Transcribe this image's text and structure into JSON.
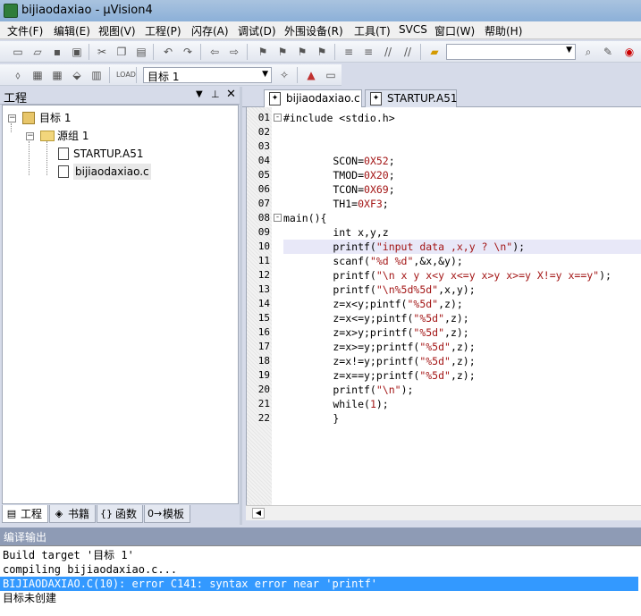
{
  "window": {
    "title": "bijiaodaxiao - µVision4"
  },
  "menu": [
    "文件(F)",
    "编辑(E)",
    "视图(V)",
    "工程(P)",
    "闪存(A)",
    "调试(D)",
    "外围设备(R)",
    "工具(T)",
    "SVCS",
    "窗口(W)",
    "帮助(H)"
  ],
  "toolbar2": {
    "target_select": "目标 1"
  },
  "project_panel": {
    "title": "工程",
    "tree": [
      {
        "label": "目标 1",
        "level": 0,
        "expander": "-",
        "icon": "target-folder-icon"
      },
      {
        "label": "源组 1",
        "level": 1,
        "expander": "-",
        "icon": "folder-icon"
      },
      {
        "label": "STARTUP.A51",
        "level": 2,
        "expander": "",
        "icon": "file-icon"
      },
      {
        "label": "bijiaodaxiao.c",
        "level": 2,
        "expander": "",
        "icon": "file-icon"
      }
    ],
    "tabs": [
      {
        "label": "工程",
        "icon": "project-icon",
        "active": true
      },
      {
        "label": "书籍",
        "icon": "books-icon",
        "active": false
      },
      {
        "label": "函数",
        "icon": "functions-icon",
        "active": false
      },
      {
        "label": "模板",
        "icon": "templates-icon",
        "active": false
      }
    ]
  },
  "editor": {
    "tabs": [
      {
        "label": "bijiaodaxiao.c",
        "active": true
      },
      {
        "label": "STARTUP.A51",
        "active": false
      }
    ],
    "highlight_line": "10",
    "lines": [
      {
        "n": "01",
        "fold": "-",
        "text": "#include <stdio.h>"
      },
      {
        "n": "02",
        "fold": "",
        "text": ""
      },
      {
        "n": "03",
        "fold": "",
        "text": ""
      },
      {
        "n": "04",
        "fold": "",
        "text": "        SCON=0X52;"
      },
      {
        "n": "05",
        "fold": "",
        "text": "        TMOD=0X20;"
      },
      {
        "n": "06",
        "fold": "",
        "text": "        TCON=0X69;"
      },
      {
        "n": "07",
        "fold": "",
        "text": "        TH1=0XF3;"
      },
      {
        "n": "08",
        "fold": "-",
        "text": "main(){"
      },
      {
        "n": "09",
        "fold": "",
        "text": "        int x,y,z"
      },
      {
        "n": "10",
        "fold": "",
        "text": "        printf(\"input data ,x,y ? \\n\");"
      },
      {
        "n": "11",
        "fold": "",
        "text": "        scanf(\"%d %d\",&x,&y);"
      },
      {
        "n": "12",
        "fold": "",
        "text": "        printf(\"\\n x y x<y x<=y x>y x>=y X!=y x==y\");"
      },
      {
        "n": "13",
        "fold": "",
        "text": "        printf(\"\\n%5d%5d\",x,y);"
      },
      {
        "n": "14",
        "fold": "",
        "text": "        z=x<y;pintf(\"%5d\",z);"
      },
      {
        "n": "15",
        "fold": "",
        "text": "        z=x<=y;pintf(\"%5d\",z);"
      },
      {
        "n": "16",
        "fold": "",
        "text": "        z=x>y;printf(\"%5d\",z);"
      },
      {
        "n": "17",
        "fold": "",
        "text": "        z=x>=y;printf(\"%5d\",z);"
      },
      {
        "n": "18",
        "fold": "",
        "text": "        z=x!=y;printf(\"%5d\",z);"
      },
      {
        "n": "19",
        "fold": "",
        "text": "        z=x==y;printf(\"%5d\",z);"
      },
      {
        "n": "20",
        "fold": "",
        "text": "        printf(\"\\n\");"
      },
      {
        "n": "21",
        "fold": "",
        "text": "        while(1);"
      },
      {
        "n": "22",
        "fold": "",
        "text": "        }"
      }
    ]
  },
  "output": {
    "title": "编译输出",
    "lines": [
      {
        "text": "Build target '目标 1'",
        "error": false
      },
      {
        "text": "compiling bijiaodaxiao.c...",
        "error": false
      },
      {
        "text": "BIJIAODAXIAO.C(10): error C141: syntax error near 'printf'",
        "error": true
      },
      {
        "text": "目标未创建",
        "error": false
      }
    ]
  },
  "colors": {
    "accent": "#3399ff",
    "panel_bg": "#d6dbe9",
    "output_title_bg": "#8e9bb5"
  }
}
